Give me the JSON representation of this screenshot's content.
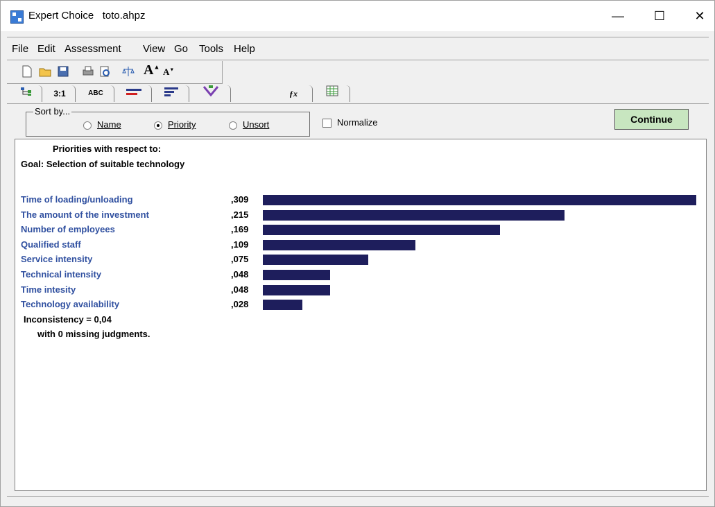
{
  "window": {
    "app_name": "Expert Choice",
    "file_name": "toto.ahpz",
    "minimize": "—",
    "maximize": "☐",
    "close": "✕"
  },
  "menu": [
    "File",
    "Edit",
    "Assessment",
    "View",
    "Go",
    "Tools",
    "Help"
  ],
  "tabs": [
    "3:1",
    "ABC"
  ],
  "sort": {
    "legend": "Sort by...",
    "options": [
      "Name",
      "Priority",
      "Unsort"
    ],
    "selected": "Priority"
  },
  "normalize": {
    "label": "Normalize",
    "checked": false
  },
  "continue_label": "Continue",
  "heading": {
    "line1": "Priorities with respect to:",
    "line2": "Goal: Selection of suitable technology"
  },
  "chart_data": {
    "type": "bar",
    "categories": [
      "Time of loading/unloading",
      "The amount of the investment",
      "Number of employees",
      "Qualified staff",
      "Service intensity",
      "Technical intensity",
      "Time intesity",
      "Technology availability"
    ],
    "values": [
      0.309,
      0.215,
      0.169,
      0.109,
      0.075,
      0.048,
      0.048,
      0.028
    ],
    "value_labels": [
      ",309",
      ",215",
      ",169",
      ",109",
      ",075",
      ",048",
      ",048",
      ",028"
    ],
    "bar_color": "#1e1e5c",
    "label_color": "#3050a0"
  },
  "inconsistency": "Inconsistency = 0,04",
  "missing_judgments": "with 0  missing judgments."
}
